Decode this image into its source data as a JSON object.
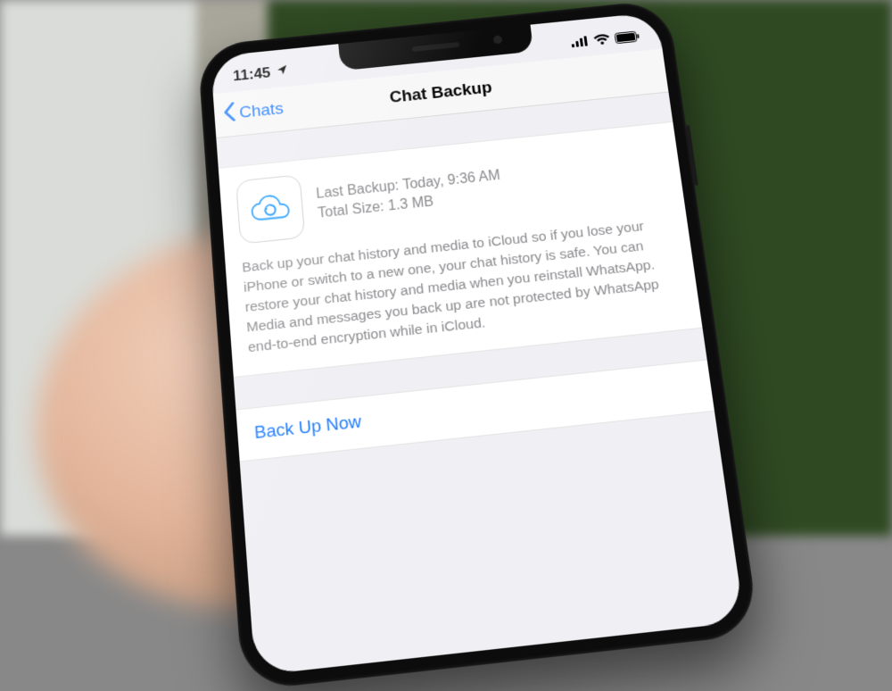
{
  "status": {
    "time": "11:45",
    "location_icon": "location-arrow-icon",
    "signal_icon": "cellular-signal-icon",
    "wifi_icon": "wifi-icon",
    "battery_icon": "battery-icon"
  },
  "nav": {
    "back_label": "Chats",
    "title": "Chat Backup"
  },
  "backup": {
    "last_label": "Last Backup:",
    "last_value": "Today, 9:36 AM",
    "size_label": "Total Size:",
    "size_value": "1.3 MB",
    "description": "Back up your chat history and media to iCloud so if you lose your iPhone or switch to a new one, your chat history is safe. You can restore your chat history and media when you reinstall WhatsApp. Media and messages you back up are not protected by WhatsApp end-to-end encryption while in iCloud.",
    "action_label": "Back Up Now"
  },
  "colors": {
    "ios_blue": "#1e7cff",
    "group_bg": "#ffffff",
    "page_bg": "#efeff4",
    "secondary_text": "#8a8a8e"
  }
}
